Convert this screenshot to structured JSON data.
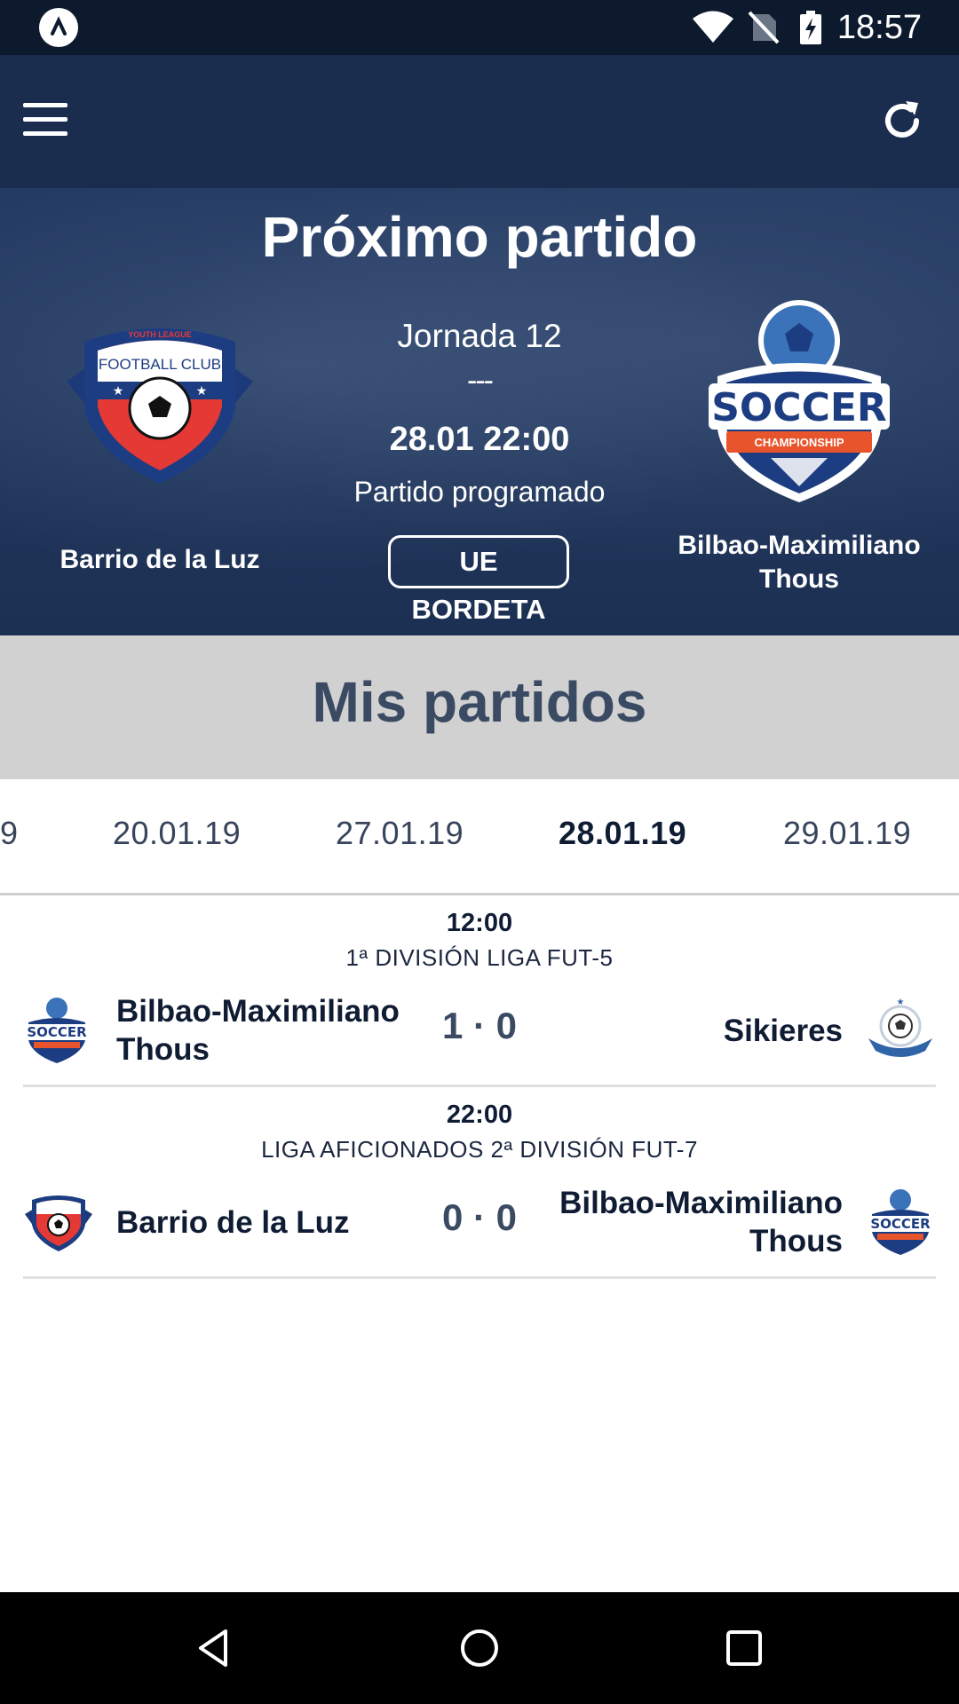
{
  "status_bar": {
    "time": "18:57"
  },
  "app_bar": {
    "menu_icon": "menu-icon",
    "refresh_icon": "refresh-icon"
  },
  "next_match": {
    "title": "Próximo partido",
    "round": "Jornada 12",
    "separator": "---",
    "datetime": "28.01 22:00",
    "status": "Partido programado",
    "venue": "UE BORDETA",
    "home_team": "Barrio de la Luz",
    "home_logo": {
      "top_text": "YOUTH LEAGUE",
      "text": "FOOTBALL CLUB"
    },
    "away_team": "Bilbao-Maximiliano Thous",
    "away_logo": {
      "text": "SOCCER",
      "ribbon": "CHAMPIONSHIP"
    }
  },
  "my_matches": {
    "title": "Mis partidos",
    "dates": [
      "9",
      "20.01.19",
      "27.01.19",
      "28.01.19",
      "29.01.19"
    ],
    "active_date": "28.01.19",
    "matches": [
      {
        "time": "12:00",
        "competition": "1ª DIVISIÓN LIGA FUT-5",
        "home": "Bilbao-Maximiliano Thous",
        "score": "1 · 0",
        "away": "Sikieres"
      },
      {
        "time": "22:00",
        "competition": "LIGA AFICIONADOS 2ª DIVISIÓN FUT-7",
        "home": "Barrio de la Luz",
        "score": "0 · 0",
        "away": "Bilbao-Maximiliano Thous"
      }
    ]
  },
  "colors": {
    "status_bar": "#0d1a2e",
    "app_bar": "#1a2d4f",
    "hero": "#22385f",
    "section_band": "#d1d1d1",
    "section_title": "#3b4a63",
    "text_dark": "#0f1c33"
  }
}
